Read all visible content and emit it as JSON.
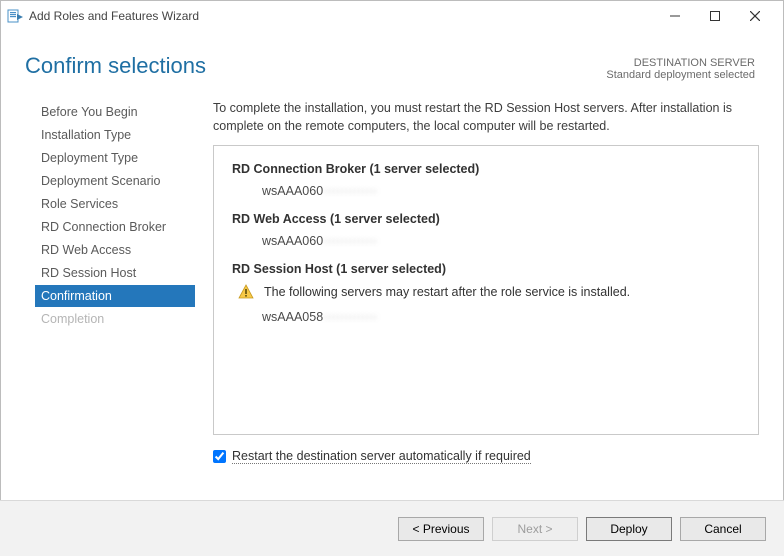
{
  "window": {
    "title": "Add Roles and Features Wizard"
  },
  "header": {
    "page_title": "Confirm selections",
    "dest_label": "DESTINATION SERVER",
    "dest_value": "Standard deployment selected"
  },
  "steps": [
    {
      "label": "Before You Begin"
    },
    {
      "label": "Installation Type"
    },
    {
      "label": "Deployment Type"
    },
    {
      "label": "Deployment Scenario"
    },
    {
      "label": "Role Services"
    },
    {
      "label": "RD Connection Broker"
    },
    {
      "label": "RD Web Access"
    },
    {
      "label": "RD Session Host"
    },
    {
      "label": "Confirmation"
    },
    {
      "label": "Completion"
    }
  ],
  "main": {
    "intro": "To complete the installation, you must restart the RD Session Host servers. After installation is complete on the remote computers, the local computer will be restarted.",
    "broker_head": "RD Connection Broker  (1 server selected)",
    "broker_server_visible": "wsAAA060",
    "broker_server_blur": "·············",
    "web_head": "RD Web Access  (1 server selected)",
    "web_server_visible": "wsAAA060",
    "web_server_blur": "·············",
    "host_head": "RD Session Host  (1 server selected)",
    "warn_text": "The following servers may restart after the role service is installed.",
    "host_server_visible": "wsAAA058",
    "host_server_blur": "·············",
    "restart_label": "Restart the destination server automatically if required"
  },
  "footer": {
    "previous": "< Previous",
    "next": "Next >",
    "deploy": "Deploy",
    "cancel": "Cancel"
  }
}
